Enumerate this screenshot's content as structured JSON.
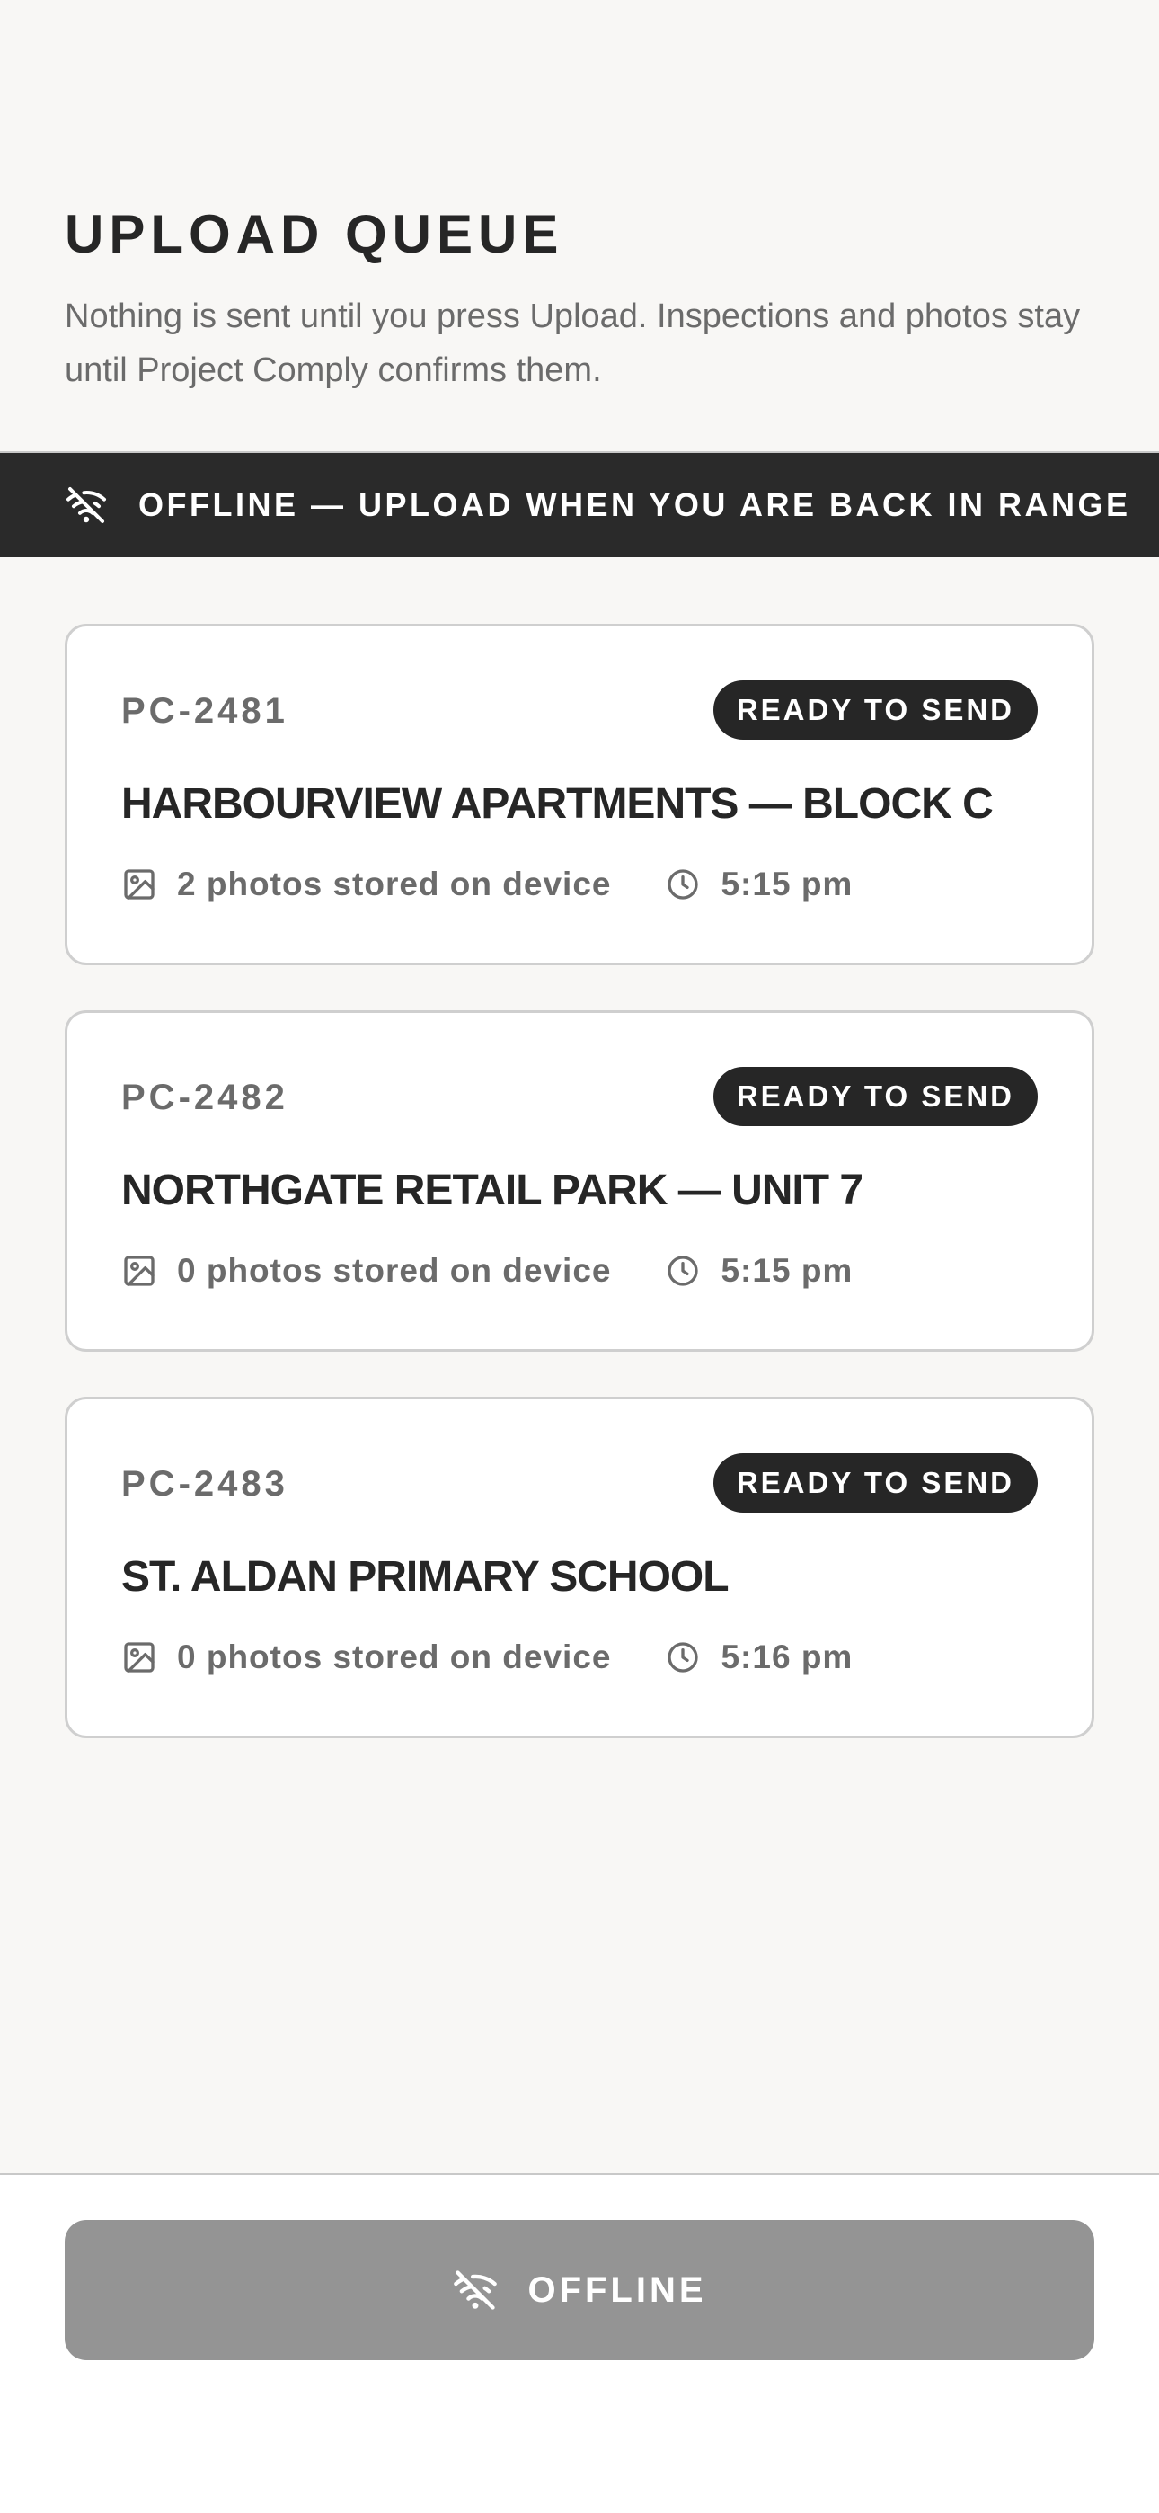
{
  "header": {
    "title": "UPLOAD QUEUE",
    "subtitle_line1": "Nothing is sent until you press Upload. Inspections and photos stay",
    "subtitle_line2": "until Project Comply confirms them."
  },
  "banner": {
    "icon": "wifi-off-icon",
    "text": "OFFLINE — UPLOAD WHEN YOU ARE BACK IN RANGE"
  },
  "queue": [
    {
      "id": "PC-2481",
      "status": "READY TO SEND",
      "title": "HARBOURVIEW APARTMENTS — BLOCK C",
      "photos": "2 photos stored on device",
      "time": "5:15 pm"
    },
    {
      "id": "PC-2482",
      "status": "READY TO SEND",
      "title": "NORTHGATE RETAIL PARK — UNIT 7",
      "photos": "0 photos stored on device",
      "time": "5:15 pm"
    },
    {
      "id": "PC-2483",
      "status": "READY TO SEND",
      "title": "ST. ALDAN PRIMARY SCHOOL",
      "photos": "0 photos stored on device",
      "time": "5:16 pm"
    }
  ],
  "footer": {
    "button_label": "OFFLINE",
    "button_icon": "wifi-off-icon"
  },
  "colors": {
    "background": "#f8f7f5",
    "banner": "#2a2a2a",
    "badge": "#262626",
    "button_disabled": "#949494",
    "muted_text": "#6b6b6b"
  }
}
